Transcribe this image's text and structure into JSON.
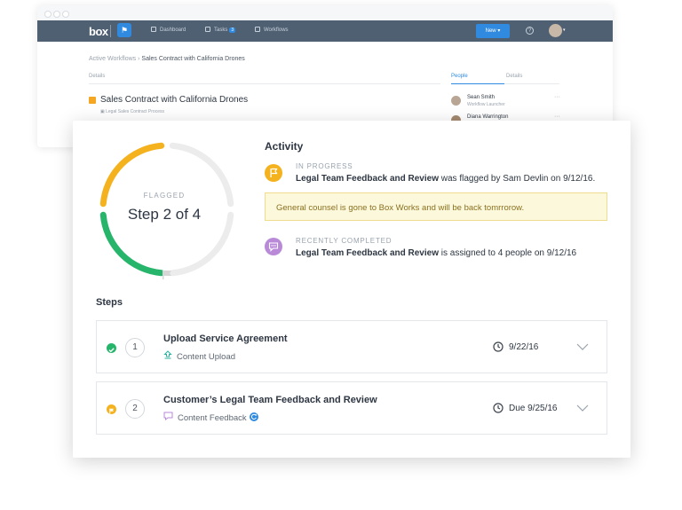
{
  "nav": {
    "logo": "box",
    "items": [
      {
        "label": "Dashboard"
      },
      {
        "label": "Tasks",
        "badge": "3"
      },
      {
        "label": "Workflows"
      }
    ],
    "new_button": "New",
    "help": "?"
  },
  "breadcrumb": {
    "root": "Active Workflows",
    "separator": "›",
    "current": "Sales Contract with California Drones"
  },
  "details": {
    "tab_label": "Details",
    "workflow_title": "Sales Contract with California Drones",
    "workflow_subtitle": "Legal Sales Contract Process"
  },
  "side_panel": {
    "tabs": [
      "People",
      "Details"
    ],
    "people": [
      {
        "name": "Sean Smith",
        "role": "Workflow Launcher",
        "more": "···"
      },
      {
        "name": "Diana Warrington",
        "role": "",
        "more": "···"
      }
    ]
  },
  "progress": {
    "status": "FLAGGED",
    "step_label": "Step 2 of 4",
    "completed_fraction": 0.25,
    "current_fraction": 0.25,
    "colors": {
      "completed": "#26b56b",
      "flagged": "#f5b21f",
      "remaining": "#ececec"
    }
  },
  "activity": {
    "heading": "Activity",
    "items": [
      {
        "label": "IN PROGRESS",
        "subject": "Legal Team Feedback and Review",
        "text": " was flagged by Sam Devlin on 9/12/16.",
        "icon": "flag-icon",
        "color": "#f5b21f"
      },
      {
        "label": "RECENTLY COMPLETED",
        "subject": "Legal Team Feedback and Review",
        "text": " is assigned to 4 people on 9/12/16",
        "icon": "comment-icon",
        "color": "#b98ad8"
      }
    ],
    "note": "General counsel is gone to Box Works and will be back tomrrorow."
  },
  "steps": {
    "heading": "Steps",
    "items": [
      {
        "number": "1",
        "title": "Upload Service Agreement",
        "type": "Content Upload",
        "date": "9/22/16",
        "status": "completed",
        "status_color": "#26b56b"
      },
      {
        "number": "2",
        "title": "Customer’s Legal Team Feedback and Review",
        "type": "Content Feedback",
        "date": "Due 9/25/16",
        "status": "flagged",
        "status_color": "#f5b21f"
      }
    ]
  }
}
